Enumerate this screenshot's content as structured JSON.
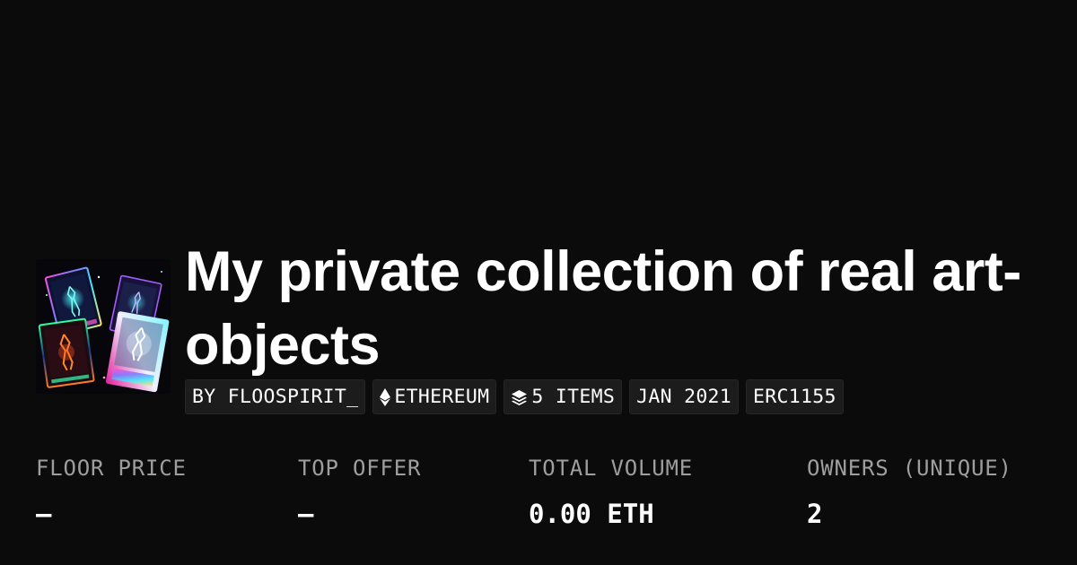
{
  "collection": {
    "title": "My private collection of real art-objects",
    "thumbnail_icon": "holographic-cards-artwork"
  },
  "badges": [
    {
      "text": "BY FLOOSPIRIT_",
      "icon": null
    },
    {
      "text": "ETHEREUM",
      "icon": "ethereum-icon"
    },
    {
      "text": "5 ITEMS",
      "icon": "layers-icon"
    },
    {
      "text": "JAN 2021",
      "icon": null
    },
    {
      "text": "ERC1155",
      "icon": null
    }
  ],
  "stats": [
    {
      "label": "FLOOR PRICE",
      "value": "–"
    },
    {
      "label": "TOP OFFER",
      "value": "–"
    },
    {
      "label": "TOTAL VOLUME",
      "value": "0.00 ETH"
    },
    {
      "label": "OWNERS (UNIQUE)",
      "value": "2"
    }
  ],
  "colors": {
    "background": "#0b0b0b",
    "badge_background": "#1c1c1c",
    "label_gray": "#9e9e9e",
    "text": "#ffffff"
  }
}
